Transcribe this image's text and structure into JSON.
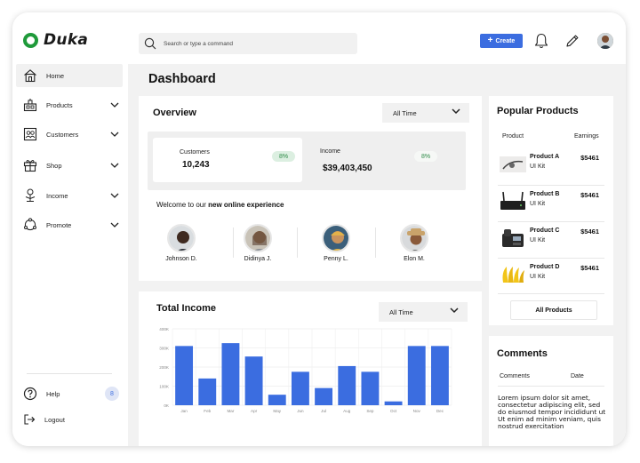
{
  "app": {
    "name": "Duka"
  },
  "search": {
    "placeholder": "Search or type a command"
  },
  "header": {
    "create_label": "Create"
  },
  "sidebar": {
    "items": [
      {
        "label": "Home",
        "icon": "home-icon"
      },
      {
        "label": "Products",
        "icon": "products-icon"
      },
      {
        "label": "Customers",
        "icon": "customers-icon"
      },
      {
        "label": "Shop",
        "icon": "gift-icon"
      },
      {
        "label": "Income",
        "icon": "income-icon"
      },
      {
        "label": "Promote",
        "icon": "promote-icon"
      }
    ],
    "help_label": "Help",
    "help_count": "8",
    "logout_label": "Logout"
  },
  "dashboard": {
    "title": "Dashboard"
  },
  "overview": {
    "title": "Overview",
    "filter": "All Time",
    "customers_label": "Customers",
    "customers_value": "10,243",
    "customers_change": "8%",
    "income_label": "Income",
    "income_value": "$39,403,450",
    "income_change": "8%",
    "welcome_prefix": "Welcome  to our ",
    "welcome_bold": "new online experience",
    "people": [
      "Johnson D.",
      "Didinya J.",
      "Penny L.",
      "Elon M."
    ]
  },
  "income": {
    "title": "Total Income",
    "filter": "All Time"
  },
  "chart_data": {
    "type": "bar",
    "title": "Total Income",
    "categories": [
      "Jan",
      "Feb",
      "Mar",
      "Apr",
      "May",
      "Jun",
      "Jul",
      "Aug",
      "Sep",
      "Oct",
      "Nov",
      "Dec"
    ],
    "values": [
      310000,
      140000,
      325000,
      255000,
      55000,
      175000,
      90000,
      205000,
      175000,
      20000,
      310000,
      310000
    ],
    "yticks": [
      "0K",
      "100K",
      "200K",
      "300K",
      "400K"
    ],
    "ylim": [
      0,
      400000
    ],
    "grid": true,
    "color": "#3b6de0"
  },
  "popular": {
    "title": "Popular Products",
    "col_product": "Product",
    "col_earnings": "Earnings",
    "items": [
      {
        "name": "Product A",
        "sub": "UI Kit",
        "price": "$5461"
      },
      {
        "name": "Product B",
        "sub": "UI Kit",
        "price": "$5461"
      },
      {
        "name": "Product C",
        "sub": "UI Kit",
        "price": "$5461"
      },
      {
        "name": "Product D",
        "sub": "UI Kit",
        "price": "$5461"
      }
    ],
    "all_label": "All Products"
  },
  "comments": {
    "title": "Comments",
    "col_comments": "Comments",
    "col_date": "Date",
    "text": "Lorem ipsum dolor sit amet, consectetur adipiscing elit, sed do eiusmod tempor incididunt ut Ut enim ad minim veniam, quis nostrud exercitation"
  }
}
